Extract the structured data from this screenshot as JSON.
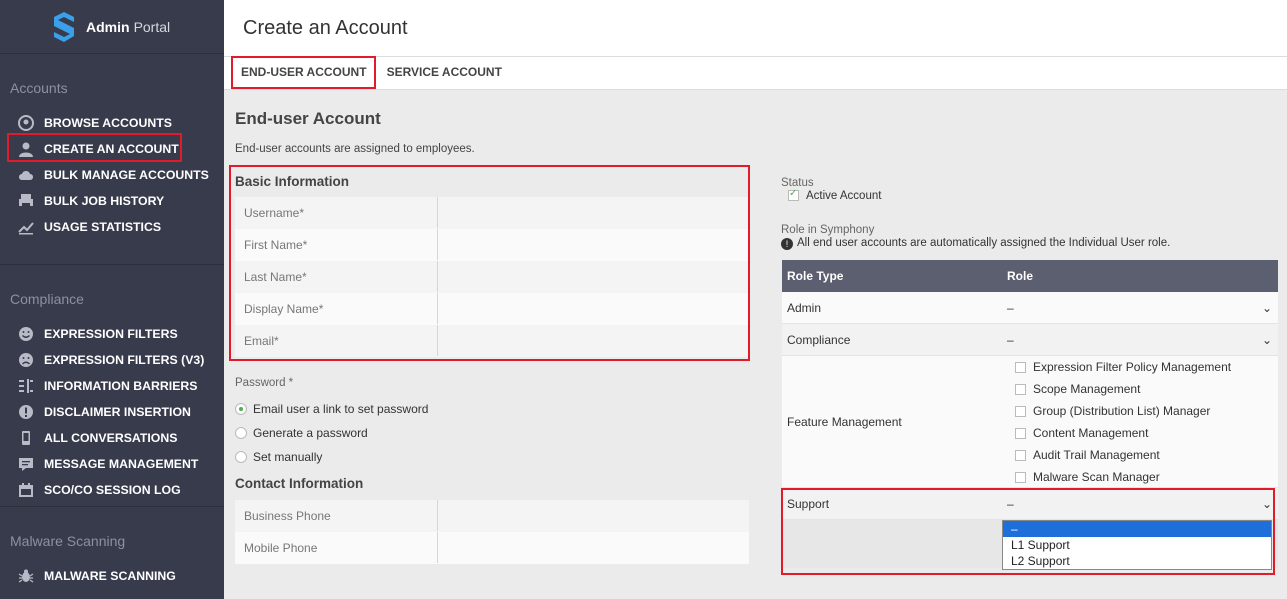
{
  "brand": {
    "name": "Admin",
    "suffix": "Portal"
  },
  "sidebar": {
    "sections": [
      {
        "title": "Accounts",
        "items": [
          {
            "label": "BROWSE ACCOUNTS",
            "icon": "search-user-icon"
          },
          {
            "label": "CREATE AN ACCOUNT",
            "icon": "user-icon"
          },
          {
            "label": "BULK MANAGE ACCOUNTS",
            "icon": "cloud-icon"
          },
          {
            "label": "BULK JOB HISTORY",
            "icon": "printer-icon"
          },
          {
            "label": "USAGE STATISTICS",
            "icon": "trend-icon"
          }
        ]
      },
      {
        "title": "Compliance",
        "items": [
          {
            "label": "EXPRESSION FILTERS",
            "icon": "smile-icon"
          },
          {
            "label": "EXPRESSION FILTERS (V3)",
            "icon": "frown-icon"
          },
          {
            "label": "INFORMATION BARRIERS",
            "icon": "barrier-icon"
          },
          {
            "label": "DISCLAIMER INSERTION",
            "icon": "alert-icon"
          },
          {
            "label": "ALL CONVERSATIONS",
            "icon": "mobile-icon"
          },
          {
            "label": "MESSAGE MANAGEMENT",
            "icon": "message-icon"
          },
          {
            "label": "SCO/CO SESSION LOG",
            "icon": "calendar-icon"
          }
        ]
      },
      {
        "title": "Malware Scanning",
        "items": [
          {
            "label": "MALWARE SCANNING",
            "icon": "bug-icon"
          }
        ]
      }
    ]
  },
  "header": {
    "title": "Create an Account"
  },
  "tabs": [
    {
      "label": "END-USER ACCOUNT"
    },
    {
      "label": "SERVICE ACCOUNT"
    }
  ],
  "form": {
    "title": "End-user Account",
    "description": "End-user accounts are assigned to employees.",
    "basic_info": {
      "title": "Basic Information",
      "fields": [
        {
          "label": "Username*"
        },
        {
          "label": "First Name*"
        },
        {
          "label": "Last Name*"
        },
        {
          "label": "Display Name*"
        },
        {
          "label": "Email*"
        }
      ]
    },
    "password": {
      "label": "Password *",
      "options": [
        {
          "label": "Email user a link to set password",
          "checked": true
        },
        {
          "label": "Generate a password",
          "checked": false
        },
        {
          "label": "Set manually",
          "checked": false
        }
      ]
    },
    "contact": {
      "title": "Contact Information",
      "fields": [
        {
          "label": "Business Phone"
        },
        {
          "label": "Mobile Phone"
        }
      ]
    }
  },
  "status": {
    "label": "Status",
    "active_label": "Active Account",
    "active": true
  },
  "role": {
    "label": "Role in Symphony",
    "note": "All end user accounts are automatically assigned the Individual User role.",
    "headers": {
      "type": "Role Type",
      "role": "Role"
    },
    "rows": [
      {
        "type": "Admin",
        "value": "–"
      },
      {
        "type": "Compliance",
        "value": "–"
      }
    ],
    "feature": {
      "type": "Feature Management",
      "options": [
        "Expression Filter Policy Management",
        "Scope Management",
        "Group (Distribution List) Manager",
        "Content Management",
        "Audit Trail Management",
        "Malware Scan Manager"
      ]
    },
    "support": {
      "type": "Support",
      "value": "–",
      "options": [
        "–",
        "L1 Support",
        "L2 Support"
      ]
    }
  },
  "colors": {
    "sidebar": "#373b4b",
    "highlight": "#e21b2a",
    "selected": "#1e6fd9",
    "table_head": "#5b5f70"
  }
}
